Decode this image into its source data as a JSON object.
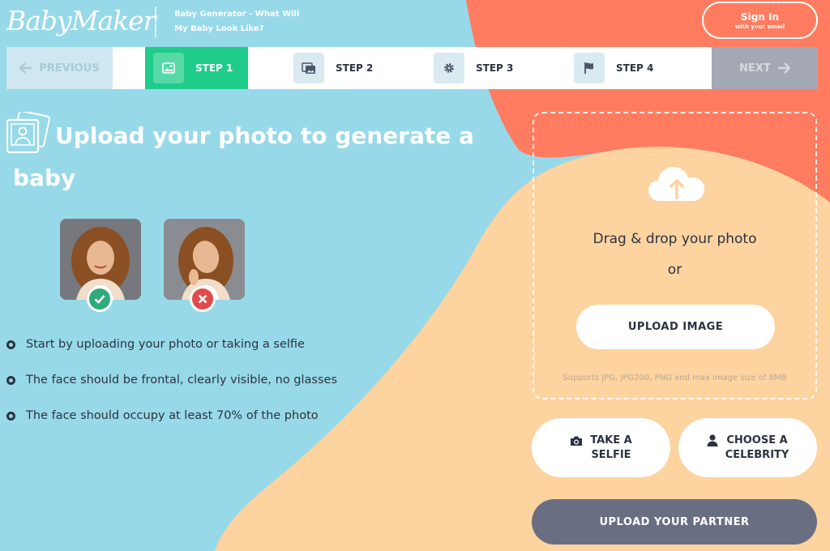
{
  "header": {
    "logo_text": "BabyMaker",
    "tagline": "Baby Generator - What Will My Baby Look Like?",
    "signin_label": "Sign In",
    "signin_sub": "with your email"
  },
  "steps_bar": {
    "previous_label": "PREVIOUS",
    "next_label": "NEXT",
    "steps": [
      {
        "label": "STEP 1",
        "icon": "image-icon",
        "active": true
      },
      {
        "label": "STEP 2",
        "icon": "images-icon",
        "active": false
      },
      {
        "label": "STEP 3",
        "icon": "gear-icon",
        "active": false
      },
      {
        "label": "STEP 4",
        "icon": "flag-icon",
        "active": false
      }
    ]
  },
  "main": {
    "title": "Upload your photo to generate a baby",
    "tips": [
      "Start by uploading your photo or taking a selfie",
      "The face should be frontal, clearly visible, no glasses",
      "The face should occupy at least 70% of the photo"
    ]
  },
  "upload": {
    "drag_text": "Drag & drop your photo",
    "or_text": "or",
    "upload_button": "UPLOAD IMAGE",
    "support_text": "Supports JPG, JPG200, PNG and max image size of 8MB"
  },
  "actions": {
    "selfie_line1": "TAKE A",
    "selfie_line2": "SELFIE",
    "celebrity_line1": "CHOOSE A",
    "celebrity_line2": "CELEBRITY",
    "partner_button": "UPLOAD YOUR PARTNER"
  },
  "colors": {
    "background_blue": "#97d9e8",
    "coral": "#ff7c60",
    "peach": "#fdd3a0",
    "accent_green": "#1fcc8a",
    "partner_button": "#6a6e82",
    "ok_badge": "#2eaa7b",
    "bad_badge": "#e04a4a"
  }
}
